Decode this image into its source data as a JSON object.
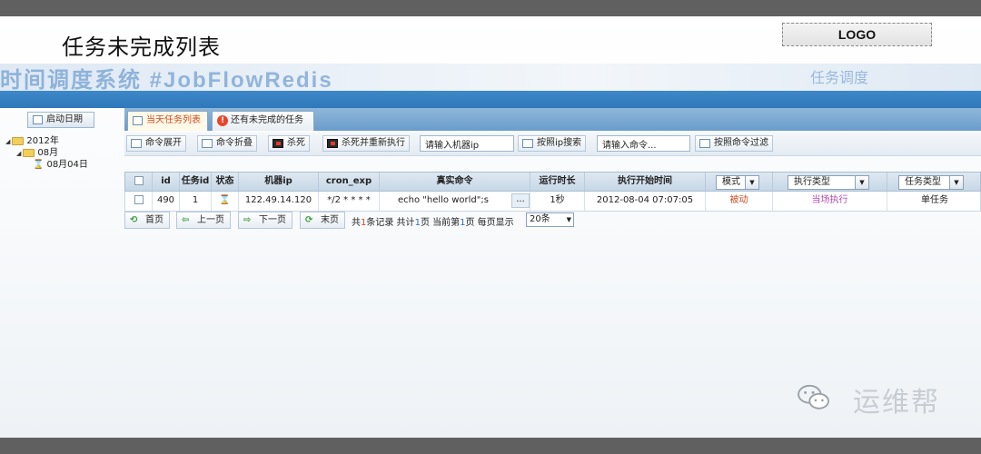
{
  "slide": {
    "title": "任务未完成列表",
    "logo": "LOGO"
  },
  "banner": {
    "text": "时间调度系统 #JobFlowRedis",
    "right_text": "任务调度"
  },
  "sidebar": {
    "start_date_button": "启动日期",
    "tree": {
      "year": "2012年",
      "month": "08月",
      "day": "08月04日"
    }
  },
  "tabs": [
    {
      "label": "当天任务列表"
    },
    {
      "label": "还有未完成的任务"
    }
  ],
  "toolbar": {
    "expand_label": "命令展开",
    "collapse_label": "命令折叠",
    "kill_label": "杀死",
    "kill_rerun_label": "杀死并重新执行",
    "ip_input_placeholder": "请输入机器ip",
    "ip_search_label": "按照ip搜索",
    "cmd_input_placeholder": "请输入命令...",
    "cmd_filter_label": "按照命令过滤"
  },
  "table": {
    "headers": {
      "id": "id",
      "task_id": "任务id",
      "status": "状态",
      "machine_ip": "机器ip",
      "cron_exp": "cron_exp",
      "command": "真实命令",
      "duration": "运行时长",
      "start_time": "执行开始时间",
      "mode": "模式",
      "exec_type": "执行类型",
      "task_type": "任务类型"
    },
    "rows": [
      {
        "id": "490",
        "task_id": "1",
        "status_icon": "hourglass-icon",
        "machine_ip": "122.49.14.120",
        "cron_exp": "*/2 * * * *",
        "command": "echo \"hello world\";s",
        "more": "...",
        "duration": "1秒",
        "start_time": "2012-08-04 07:07:05",
        "mode": "被动",
        "exec_type": "当场执行",
        "task_type": "单任务"
      }
    ]
  },
  "pager": {
    "first_label": "首页",
    "prev_label": "上一页",
    "next_label": "下一页",
    "last_label": "末页",
    "info_1": "共",
    "total_records": "1",
    "info_2": "条记录 共计",
    "total_pages": "1",
    "info_3": "页 当前第",
    "current_page": "1",
    "info_4": "页 每页显示",
    "page_size": "20条"
  },
  "watermark": {
    "text": "运维帮"
  },
  "colors": {
    "accent_blue": "#3d88c9",
    "active_tab_text": "#d0491e",
    "mode_text": "#d0491e",
    "exec_type_text": "#b04bb0"
  }
}
